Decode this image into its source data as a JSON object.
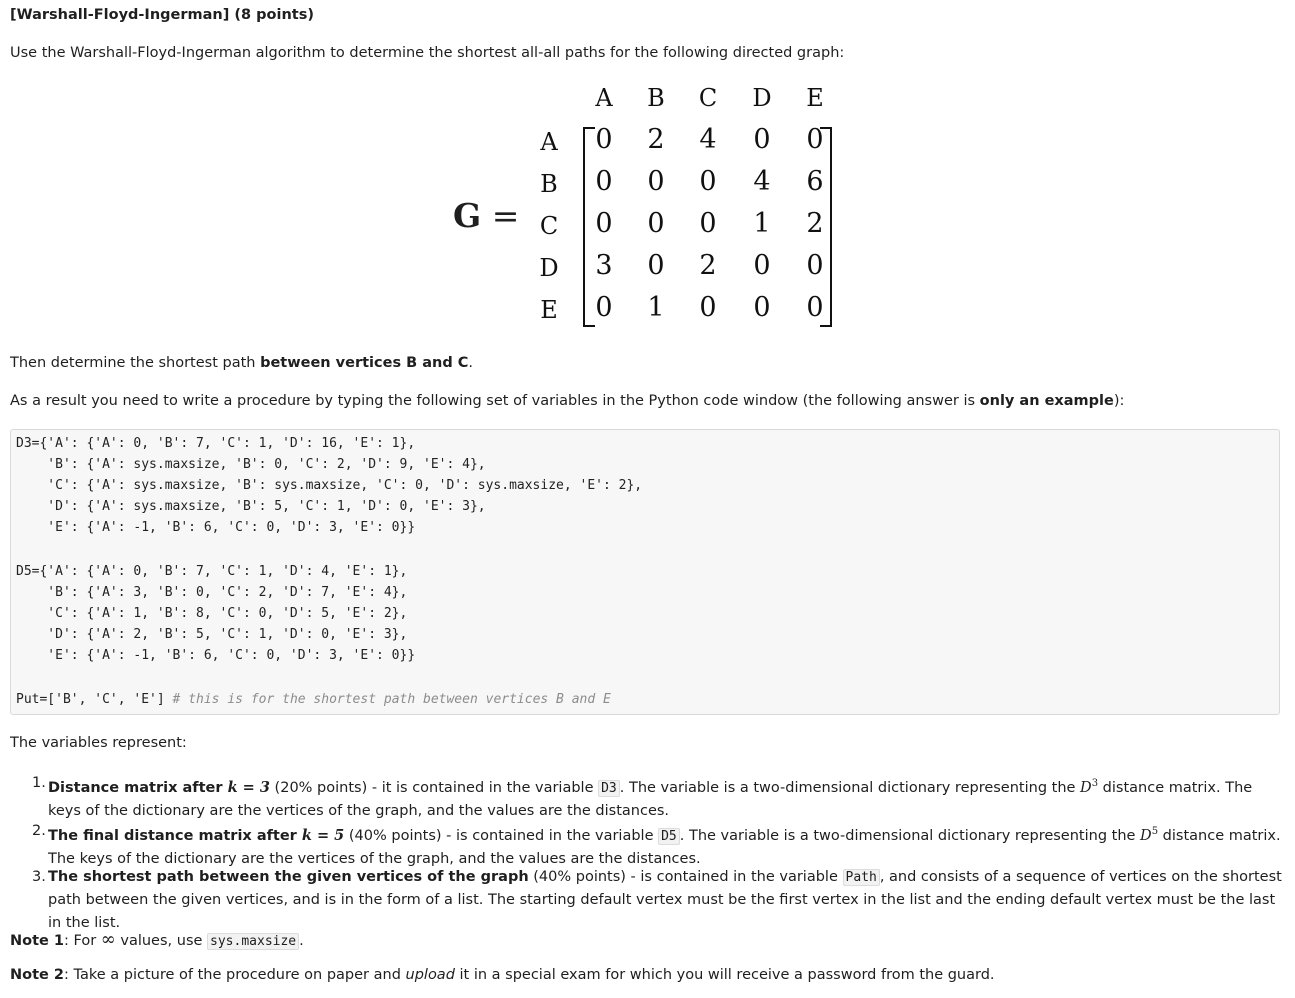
{
  "title": "[Warshall-Floyd-Ingerman] (8 points)",
  "intro": "Use the Warshall-Floyd-Ingerman algorithm to determine the shortest all-all paths for the following directed graph:",
  "matrix": {
    "label": "G",
    "equals": "=",
    "cols": [
      "A",
      "B",
      "C",
      "D",
      "E"
    ],
    "rows": [
      "A",
      "B",
      "C",
      "D",
      "E"
    ],
    "values": [
      [
        "0",
        "2",
        "4",
        "0",
        "0"
      ],
      [
        "0",
        "0",
        "0",
        "4",
        "6"
      ],
      [
        "0",
        "0",
        "0",
        "1",
        "2"
      ],
      [
        "3",
        "0",
        "2",
        "0",
        "0"
      ],
      [
        "0",
        "1",
        "0",
        "0",
        "0"
      ]
    ]
  },
  "then": {
    "prefix": "Then determine the shortest path ",
    "bold": "between vertices B and C",
    "suffix": "."
  },
  "result": {
    "prefix": "As a result you need to write a procedure by typing the following set of variables in the Python code window (the following answer is ",
    "bold": "only an example",
    "suffix": "):"
  },
  "code": {
    "lines": [
      "D3={'A': {'A': 0, 'B': 7, 'C': 1, 'D': 16, 'E': 1},",
      "    'B': {'A': sys.maxsize, 'B': 0, 'C': 2, 'D': 9, 'E': 4},",
      "    'C': {'A': sys.maxsize, 'B': sys.maxsize, 'C': 0, 'D': sys.maxsize, 'E': 2},",
      "    'D': {'A': sys.maxsize, 'B': 5, 'C': 1, 'D': 0, 'E': 3},",
      "    'E': {'A': -1, 'B': 6, 'C': 0, 'D': 3, 'E': 0}}",
      "D5={'A': {'A': 0, 'B': 7, 'C': 1, 'D': 4, 'E': 1},",
      "    'B': {'A': 3, 'B': 0, 'C': 2, 'D': 7, 'E': 4},",
      "    'C': {'A': 1, 'B': 8, 'C': 0, 'D': 5, 'E': 2},",
      "    'D': {'A': 2, 'B': 5, 'C': 1, 'D': 0, 'E': 3},",
      "    'E': {'A': -1, 'B': 6, 'C': 0, 'D': 3, 'E': 0}}"
    ],
    "put_line": "Put=['B', 'C', 'E'] ",
    "put_comment": "# this is for the shortest path between vertices B and E"
  },
  "vars_intro": "The variables represent:",
  "items": [
    {
      "num": "1.",
      "bold": "Distance matrix after ",
      "k_eq": "k = 3",
      "t1": " (20% points) - it is contained in the variable ",
      "var": "D3",
      "t2": ". The variable is a two-dimensional dictionary representing the ",
      "dsym": "D",
      "dsup": "3",
      "t3": " distance matrix. The keys of the dictionary are the vertices of the graph, and the values are the distances."
    },
    {
      "num": "2.",
      "bold": "The final distance matrix after ",
      "k_eq": "k = 5",
      "t1": " (40% points) - is contained in the variable ",
      "var": "D5",
      "t2": ". The variable is a two-dimensional dictionary representing the ",
      "dsym": "D",
      "dsup": "5",
      "t3": " distance matrix. The keys of the dictionary are the vertices of the graph, and the values are the distances."
    },
    {
      "num": "3.",
      "bold": "The shortest path between the given vertices of the graph",
      "t1": " (40% points) - is contained in the variable ",
      "var": "Path",
      "t2": ", and consists of a sequence of vertices on the shortest path between the given vertices, and is in the form of a list. The starting default vertex must be the first vertex in the list and the ending default vertex must be the last in the list."
    }
  ],
  "note1": {
    "label": "Note 1",
    "t1": ": For ",
    "inf": "∞",
    "t2": " values, use ",
    "code": "sys.maxsize",
    "t3": "."
  },
  "note2": {
    "label": "Note 2",
    "t1": ": Take a picture of the procedure on paper and ",
    "em": "upload",
    "t2": " it in a special exam for which you will receive a password from the guard."
  }
}
